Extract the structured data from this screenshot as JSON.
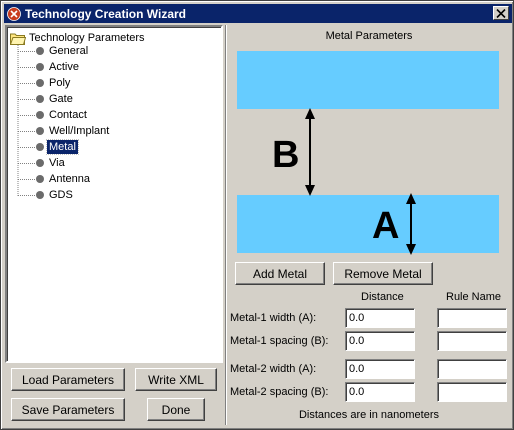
{
  "window": {
    "title": "Technology Creation Wizard"
  },
  "tree": {
    "root_label": "Technology Parameters",
    "items": [
      {
        "label": "General"
      },
      {
        "label": "Active"
      },
      {
        "label": "Poly"
      },
      {
        "label": "Gate"
      },
      {
        "label": "Contact"
      },
      {
        "label": "Well/Implant"
      },
      {
        "label": "Metal",
        "selected": true
      },
      {
        "label": "Via"
      },
      {
        "label": "Antenna"
      },
      {
        "label": "GDS"
      }
    ]
  },
  "left_buttons": {
    "load": "Load Parameters",
    "write_xml": "Write XML",
    "save": "Save Parameters",
    "done": "Done"
  },
  "panel": {
    "title": "Metal Parameters",
    "diagram_label_b": "B",
    "diagram_label_a": "A",
    "metal_color": "#66ccff",
    "add_metal": "Add Metal",
    "remove_metal": "Remove Metal",
    "col_distance": "Distance",
    "col_rule_name": "Rule Name",
    "rows": [
      {
        "label": "Metal-1 width (A):",
        "distance": "0.0",
        "rule_name": ""
      },
      {
        "label": "Metal-1 spacing (B):",
        "distance": "0.0",
        "rule_name": ""
      },
      {
        "label": "Metal-2 width (A):",
        "distance": "0.0",
        "rule_name": ""
      },
      {
        "label": "Metal-2 spacing (B):",
        "distance": "0.0",
        "rule_name": ""
      }
    ],
    "footnote": "Distances are in nanometers"
  }
}
